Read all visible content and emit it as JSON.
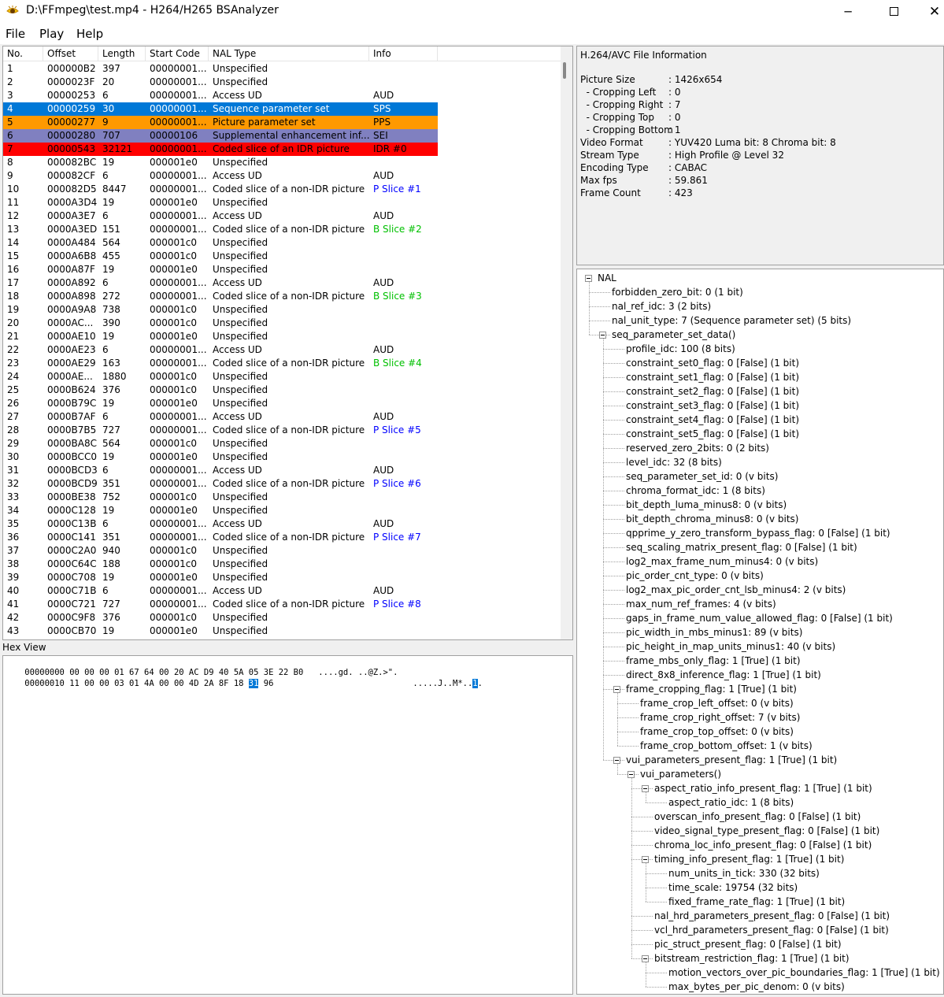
{
  "window": {
    "title": "D:\\FFmpeg\\test.mp4 - H264/H265 BSAnalyzer",
    "minimize": "─",
    "close": "✕"
  },
  "menu": [
    "File",
    "Play",
    "Help"
  ],
  "table": {
    "columns": [
      "No.",
      "Offset",
      "Length",
      "Start Code",
      "NAL Type",
      "Info"
    ],
    "rows": [
      {
        "no": "1",
        "offset": "000000B2",
        "length": "397",
        "start": "00000001...",
        "type": "Unspecified",
        "info": "",
        "style": ""
      },
      {
        "no": "2",
        "offset": "0000023F",
        "length": "20",
        "start": "00000001...",
        "type": "Unspecified",
        "info": "",
        "style": ""
      },
      {
        "no": "3",
        "offset": "00000253",
        "length": "6",
        "start": "00000001...",
        "type": "Access UD",
        "info": "AUD",
        "style": ""
      },
      {
        "no": "4",
        "offset": "00000259",
        "length": "30",
        "start": "00000001...",
        "type": "Sequence parameter set",
        "info": "SPS",
        "style": "sps"
      },
      {
        "no": "5",
        "offset": "00000277",
        "length": "9",
        "start": "00000001...",
        "type": "Picture parameter set",
        "info": "PPS",
        "style": "pps"
      },
      {
        "no": "6",
        "offset": "00000280",
        "length": "707",
        "start": "00000106",
        "type": "Supplemental enhancement inf...",
        "info": "SEI",
        "style": "sei"
      },
      {
        "no": "7",
        "offset": "00000543",
        "length": "32121",
        "start": "00000001...",
        "type": "Coded slice of an IDR picture",
        "info": "IDR #0",
        "style": "idr"
      },
      {
        "no": "8",
        "offset": "000082BC",
        "length": "19",
        "start": "000001e0",
        "type": "Unspecified",
        "info": "",
        "style": ""
      },
      {
        "no": "9",
        "offset": "000082CF",
        "length": "6",
        "start": "00000001...",
        "type": "Access UD",
        "info": "AUD",
        "style": ""
      },
      {
        "no": "10",
        "offset": "000082D5",
        "length": "8447",
        "start": "00000001...",
        "type": "Coded slice of a non-IDR picture",
        "info": "P Slice #1",
        "style": "p"
      },
      {
        "no": "11",
        "offset": "0000A3D4",
        "length": "19",
        "start": "000001e0",
        "type": "Unspecified",
        "info": "",
        "style": ""
      },
      {
        "no": "12",
        "offset": "0000A3E7",
        "length": "6",
        "start": "00000001...",
        "type": "Access UD",
        "info": "AUD",
        "style": ""
      },
      {
        "no": "13",
        "offset": "0000A3ED",
        "length": "151",
        "start": "00000001...",
        "type": "Coded slice of a non-IDR picture",
        "info": "B Slice #2",
        "style": "b"
      },
      {
        "no": "14",
        "offset": "0000A484",
        "length": "564",
        "start": "000001c0",
        "type": "Unspecified",
        "info": "",
        "style": ""
      },
      {
        "no": "15",
        "offset": "0000A6B8",
        "length": "455",
        "start": "000001c0",
        "type": "Unspecified",
        "info": "",
        "style": ""
      },
      {
        "no": "16",
        "offset": "0000A87F",
        "length": "19",
        "start": "000001e0",
        "type": "Unspecified",
        "info": "",
        "style": ""
      },
      {
        "no": "17",
        "offset": "0000A892",
        "length": "6",
        "start": "00000001...",
        "type": "Access UD",
        "info": "AUD",
        "style": ""
      },
      {
        "no": "18",
        "offset": "0000A898",
        "length": "272",
        "start": "00000001...",
        "type": "Coded slice of a non-IDR picture",
        "info": "B Slice #3",
        "style": "b"
      },
      {
        "no": "19",
        "offset": "0000A9A8",
        "length": "738",
        "start": "000001c0",
        "type": "Unspecified",
        "info": "",
        "style": ""
      },
      {
        "no": "20",
        "offset": "0000AC...",
        "length": "390",
        "start": "000001c0",
        "type": "Unspecified",
        "info": "",
        "style": ""
      },
      {
        "no": "21",
        "offset": "0000AE10",
        "length": "19",
        "start": "000001e0",
        "type": "Unspecified",
        "info": "",
        "style": ""
      },
      {
        "no": "22",
        "offset": "0000AE23",
        "length": "6",
        "start": "00000001...",
        "type": "Access UD",
        "info": "AUD",
        "style": ""
      },
      {
        "no": "23",
        "offset": "0000AE29",
        "length": "163",
        "start": "00000001...",
        "type": "Coded slice of a non-IDR picture",
        "info": "B Slice #4",
        "style": "b"
      },
      {
        "no": "24",
        "offset": "0000AE...",
        "length": "1880",
        "start": "000001c0",
        "type": "Unspecified",
        "info": "",
        "style": ""
      },
      {
        "no": "25",
        "offset": "0000B624",
        "length": "376",
        "start": "000001c0",
        "type": "Unspecified",
        "info": "",
        "style": ""
      },
      {
        "no": "26",
        "offset": "0000B79C",
        "length": "19",
        "start": "000001e0",
        "type": "Unspecified",
        "info": "",
        "style": ""
      },
      {
        "no": "27",
        "offset": "0000B7AF",
        "length": "6",
        "start": "00000001...",
        "type": "Access UD",
        "info": "AUD",
        "style": ""
      },
      {
        "no": "28",
        "offset": "0000B7B5",
        "length": "727",
        "start": "00000001...",
        "type": "Coded slice of a non-IDR picture",
        "info": "P Slice #5",
        "style": "p"
      },
      {
        "no": "29",
        "offset": "0000BA8C",
        "length": "564",
        "start": "000001c0",
        "type": "Unspecified",
        "info": "",
        "style": ""
      },
      {
        "no": "30",
        "offset": "0000BCC0",
        "length": "19",
        "start": "000001e0",
        "type": "Unspecified",
        "info": "",
        "style": ""
      },
      {
        "no": "31",
        "offset": "0000BCD3",
        "length": "6",
        "start": "00000001...",
        "type": "Access UD",
        "info": "AUD",
        "style": ""
      },
      {
        "no": "32",
        "offset": "0000BCD9",
        "length": "351",
        "start": "00000001...",
        "type": "Coded slice of a non-IDR picture",
        "info": "P Slice #6",
        "style": "p"
      },
      {
        "no": "33",
        "offset": "0000BE38",
        "length": "752",
        "start": "000001c0",
        "type": "Unspecified",
        "info": "",
        "style": ""
      },
      {
        "no": "34",
        "offset": "0000C128",
        "length": "19",
        "start": "000001e0",
        "type": "Unspecified",
        "info": "",
        "style": ""
      },
      {
        "no": "35",
        "offset": "0000C13B",
        "length": "6",
        "start": "00000001...",
        "type": "Access UD",
        "info": "AUD",
        "style": ""
      },
      {
        "no": "36",
        "offset": "0000C141",
        "length": "351",
        "start": "00000001...",
        "type": "Coded slice of a non-IDR picture",
        "info": "P Slice #7",
        "style": "p"
      },
      {
        "no": "37",
        "offset": "0000C2A0",
        "length": "940",
        "start": "000001c0",
        "type": "Unspecified",
        "info": "",
        "style": ""
      },
      {
        "no": "38",
        "offset": "0000C64C",
        "length": "188",
        "start": "000001c0",
        "type": "Unspecified",
        "info": "",
        "style": ""
      },
      {
        "no": "39",
        "offset": "0000C708",
        "length": "19",
        "start": "000001e0",
        "type": "Unspecified",
        "info": "",
        "style": ""
      },
      {
        "no": "40",
        "offset": "0000C71B",
        "length": "6",
        "start": "00000001...",
        "type": "Access UD",
        "info": "AUD",
        "style": ""
      },
      {
        "no": "41",
        "offset": "0000C721",
        "length": "727",
        "start": "00000001...",
        "type": "Coded slice of a non-IDR picture",
        "info": "P Slice #8",
        "style": "p"
      },
      {
        "no": "42",
        "offset": "0000C9F8",
        "length": "376",
        "start": "000001c0",
        "type": "Unspecified",
        "info": "",
        "style": ""
      },
      {
        "no": "43",
        "offset": "0000CB70",
        "length": "19",
        "start": "000001e0",
        "type": "Unspecified",
        "info": "",
        "style": ""
      }
    ]
  },
  "row_styles": {
    "sps": {
      "bg": "#0078d7",
      "fg": "#ffffff",
      "info": "#ffffff"
    },
    "pps": {
      "bg": "#ff9900",
      "fg": "#000000",
      "info": "#000000"
    },
    "sei": {
      "bg": "#8080c0",
      "fg": "#000000",
      "info": "#000000"
    },
    "idr": {
      "bg": "#ff0000",
      "fg": "#000000",
      "info": "#000000"
    },
    "p": {
      "bg": "",
      "fg": "#000000",
      "info": "#0000ff"
    },
    "b": {
      "bg": "",
      "fg": "#000000",
      "info": "#00c000"
    }
  },
  "hex_view": {
    "label": "Hex View",
    "lines": [
      {
        "addr": "00000000",
        "bytes": "00 00 00 01 67 64 00 20 AC D9 40 5A 05 3E 22 B0",
        "ascii": "....gd. ..@Z.>\"."
      },
      {
        "addr": "00000010",
        "bytes_pre": "11 00 00 03 01 4A 00 00 4D 2A 8F 18 ",
        "bytes_hl": "31",
        "bytes_post": " 96",
        "ascii_pre": ".....J..M*..",
        "ascii_hl": "1",
        "ascii_post": "."
      }
    ]
  },
  "file_info": {
    "title": "H.264/AVC File Information",
    "rows": [
      {
        "key": "Picture Size",
        "val": ": 1426x654"
      },
      {
        "key": "  - Cropping Left",
        "val": ": 0"
      },
      {
        "key": "  - Cropping Right",
        "val": ": 7"
      },
      {
        "key": "  - Cropping Top",
        "val": ": 0"
      },
      {
        "key": "  - Cropping Bottom",
        "val": ": 1"
      },
      {
        "key": "Video Format",
        "val": ": YUV420 Luma bit: 8 Chroma bit: 8"
      },
      {
        "key": "Stream Type",
        "val": ": High Profile @ Level 32"
      },
      {
        "key": "Encoding Type",
        "val": ": CABAC"
      },
      {
        "key": "Max fps",
        "val": ": 59.861"
      },
      {
        "key": "Frame Count",
        "val": ": 423"
      }
    ]
  },
  "tree": [
    {
      "d": 0,
      "t": "NAL",
      "exp": true
    },
    {
      "d": 1,
      "t": "forbidden_zero_bit: 0 (1 bit)"
    },
    {
      "d": 1,
      "t": "nal_ref_idc: 3 (2 bits)"
    },
    {
      "d": 1,
      "t": "nal_unit_type: 7 (Sequence parameter set) (5 bits)"
    },
    {
      "d": 1,
      "t": "seq_parameter_set_data()",
      "exp": true
    },
    {
      "d": 2,
      "t": "profile_idc: 100  (8 bits)"
    },
    {
      "d": 2,
      "t": "constraint_set0_flag: 0  [False] (1 bit)"
    },
    {
      "d": 2,
      "t": "constraint_set1_flag: 0  [False] (1 bit)"
    },
    {
      "d": 2,
      "t": "constraint_set2_flag: 0  [False] (1 bit)"
    },
    {
      "d": 2,
      "t": "constraint_set3_flag: 0  [False] (1 bit)"
    },
    {
      "d": 2,
      "t": "constraint_set4_flag: 0  [False] (1 bit)"
    },
    {
      "d": 2,
      "t": "constraint_set5_flag: 0  [False] (1 bit)"
    },
    {
      "d": 2,
      "t": "reserved_zero_2bits: 0  (2 bits)"
    },
    {
      "d": 2,
      "t": "level_idc: 32  (8 bits)"
    },
    {
      "d": 2,
      "t": "seq_parameter_set_id: 0  (v bits)"
    },
    {
      "d": 2,
      "t": "chroma_format_idc: 1  (8 bits)"
    },
    {
      "d": 2,
      "t": "bit_depth_luma_minus8: 0  (v bits)"
    },
    {
      "d": 2,
      "t": "bit_depth_chroma_minus8: 0  (v bits)"
    },
    {
      "d": 2,
      "t": "qpprime_y_zero_transform_bypass_flag: 0  [False] (1 bit)"
    },
    {
      "d": 2,
      "t": "seq_scaling_matrix_present_flag: 0  [False] (1 bit)"
    },
    {
      "d": 2,
      "t": "log2_max_frame_num_minus4: 0  (v bits)"
    },
    {
      "d": 2,
      "t": "pic_order_cnt_type: 0  (v bits)"
    },
    {
      "d": 2,
      "t": "log2_max_pic_order_cnt_lsb_minus4: 2  (v bits)"
    },
    {
      "d": 2,
      "t": "max_num_ref_frames: 4  (v bits)"
    },
    {
      "d": 2,
      "t": "gaps_in_frame_num_value_allowed_flag: 0  [False] (1 bit)"
    },
    {
      "d": 2,
      "t": "pic_width_in_mbs_minus1: 89  (v bits)"
    },
    {
      "d": 2,
      "t": "pic_height_in_map_units_minus1: 40  (v bits)"
    },
    {
      "d": 2,
      "t": "frame_mbs_only_flag: 1  [True] (1 bit)"
    },
    {
      "d": 2,
      "t": "direct_8x8_inference_flag: 1  [True] (1 bit)"
    },
    {
      "d": 2,
      "t": "frame_cropping_flag: 1  [True] (1 bit)",
      "exp": true
    },
    {
      "d": 3,
      "t": "frame_crop_left_offset: 0  (v bits)"
    },
    {
      "d": 3,
      "t": "frame_crop_right_offset: 7  (v bits)"
    },
    {
      "d": 3,
      "t": "frame_crop_top_offset: 0  (v bits)"
    },
    {
      "d": 3,
      "t": "frame_crop_bottom_offset: 1  (v bits)"
    },
    {
      "d": 2,
      "t": "vui_parameters_present_flag: 1  [True] (1 bit)",
      "exp": true
    },
    {
      "d": 3,
      "t": "vui_parameters()",
      "exp": true
    },
    {
      "d": 4,
      "t": "aspect_ratio_info_present_flag: 1  [True] (1 bit)",
      "exp": true
    },
    {
      "d": 5,
      "t": "aspect_ratio_idc: 1  (8 bits)"
    },
    {
      "d": 4,
      "t": "overscan_info_present_flag: 0  [False] (1 bit)"
    },
    {
      "d": 4,
      "t": "video_signal_type_present_flag: 0  [False] (1 bit)"
    },
    {
      "d": 4,
      "t": "chroma_loc_info_present_flag: 0  [False] (1 bit)"
    },
    {
      "d": 4,
      "t": "timing_info_present_flag: 1  [True] (1 bit)",
      "exp": true
    },
    {
      "d": 5,
      "t": "num_units_in_tick: 330  (32 bits)"
    },
    {
      "d": 5,
      "t": "time_scale: 19754  (32 bits)"
    },
    {
      "d": 5,
      "t": "fixed_frame_rate_flag: 1  [True] (1 bit)"
    },
    {
      "d": 4,
      "t": "nal_hrd_parameters_present_flag: 0  [False] (1 bit)"
    },
    {
      "d": 4,
      "t": "vcl_hrd_parameters_present_flag: 0  [False] (1 bit)"
    },
    {
      "d": 4,
      "t": "pic_struct_present_flag: 0  [False] (1 bit)"
    },
    {
      "d": 4,
      "t": "bitstream_restriction_flag: 1  [True] (1 bit)",
      "exp": true
    },
    {
      "d": 5,
      "t": "motion_vectors_over_pic_boundaries_flag: 1  [True] (1 bit)"
    },
    {
      "d": 5,
      "t": "max_bytes_per_pic_denom: 0  (v bits)"
    }
  ]
}
